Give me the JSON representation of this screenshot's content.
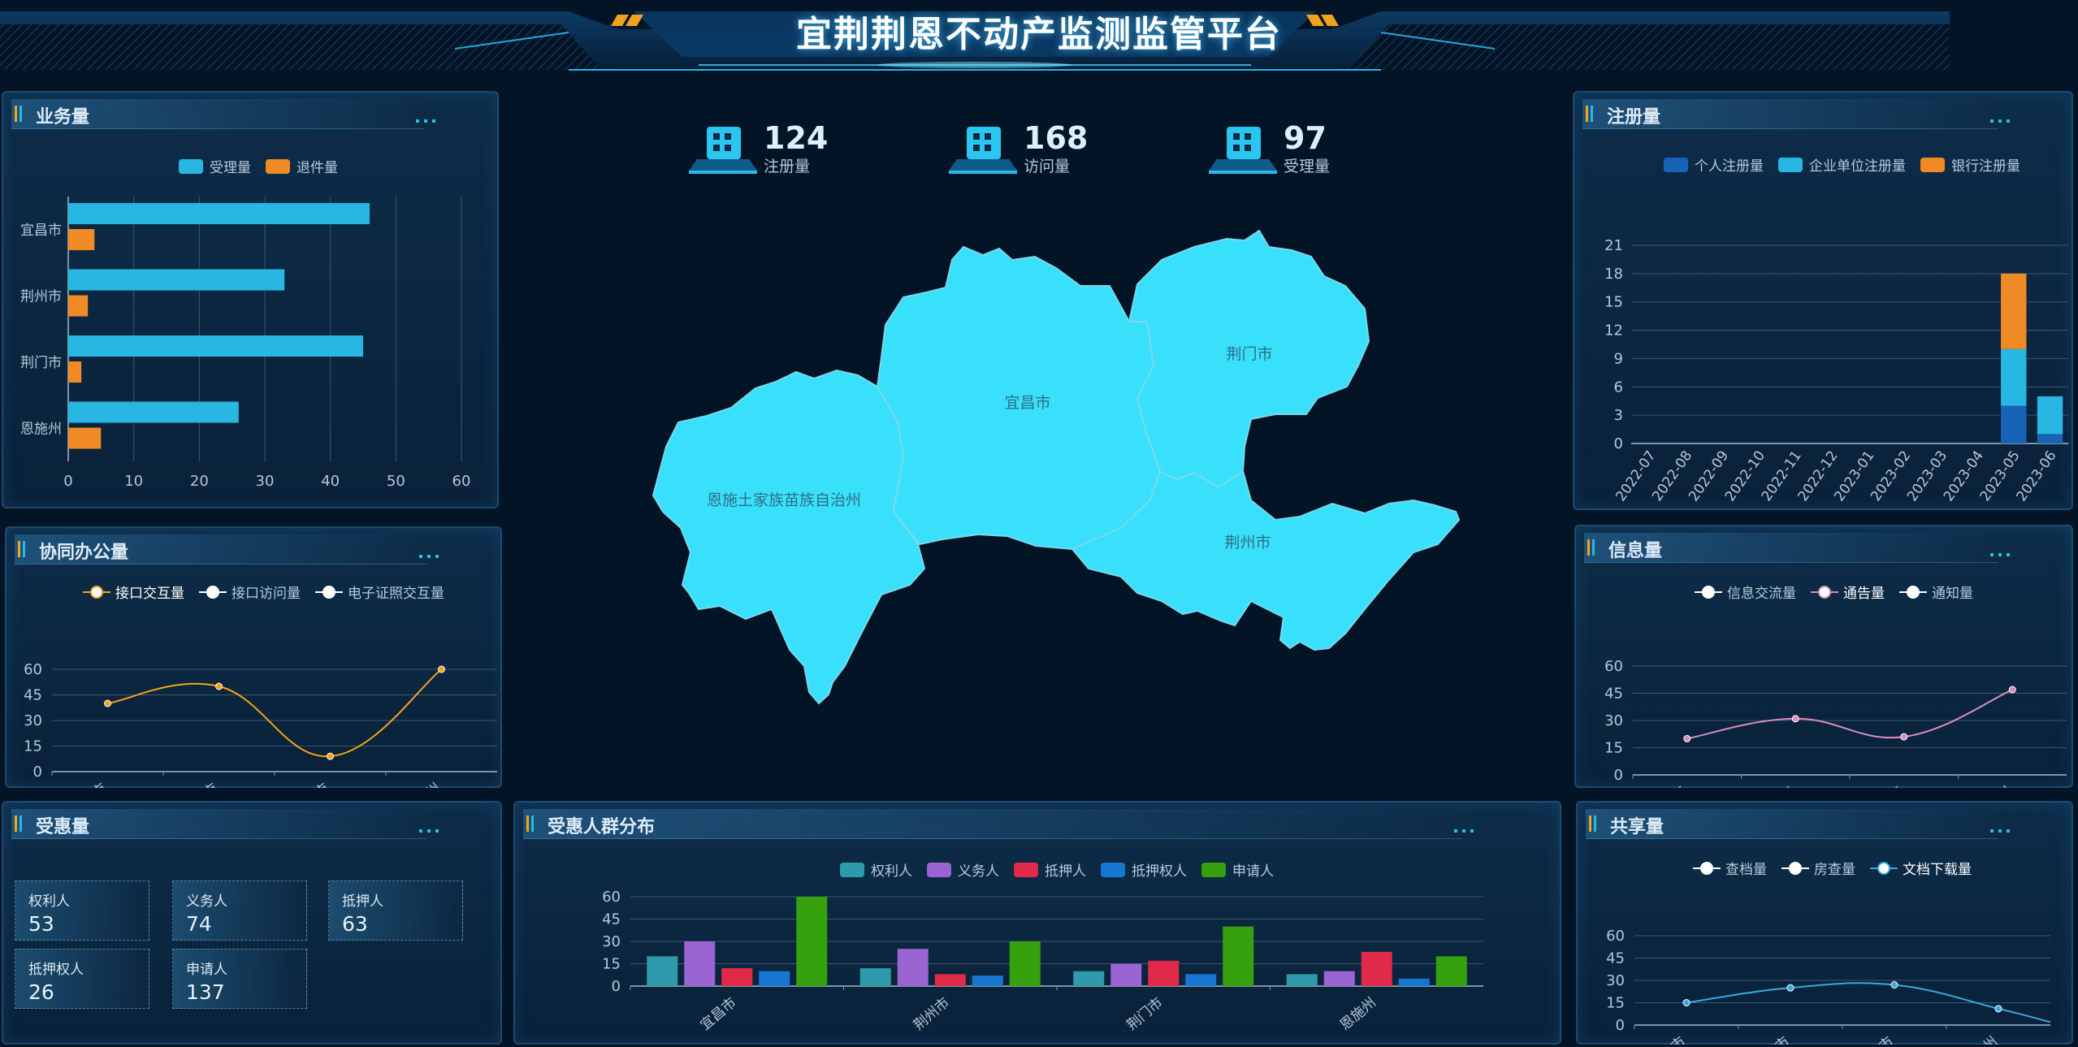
{
  "page": {
    "title": "宜荆荆恩不动产监测监管平台"
  },
  "kpis": [
    {
      "value": "124",
      "label": "注册量"
    },
    {
      "value": "168",
      "label": "访问量"
    },
    {
      "value": "97",
      "label": "受理量"
    }
  ],
  "colors": {
    "cyan": "#28b7e3",
    "orange": "#f08a24",
    "map": "#38e0fb"
  },
  "map": {
    "regions": [
      "宜昌市",
      "荆门市",
      "恩施土家族苗族自治州",
      "荆州市"
    ]
  },
  "beneficiary_cards": [
    {
      "label": "权利人",
      "value": "53"
    },
    {
      "label": "义务人",
      "value": "74"
    },
    {
      "label": "抵押人",
      "value": "63"
    },
    {
      "label": "抵押权人",
      "value": "26"
    },
    {
      "label": "申请人",
      "value": "137"
    }
  ],
  "panels": {
    "business": "业务量",
    "collab": "协同办公量",
    "benefit": "受惠量",
    "register": "注册量",
    "info": "信息量",
    "share": "共享量",
    "crowd": "受惠人群分布"
  },
  "chart_data": [
    {
      "id": "business",
      "type": "bar",
      "orientation": "horizontal",
      "title": "业务量",
      "categories": [
        "宜昌市",
        "荆州市",
        "荆门市",
        "恩施州"
      ],
      "series": [
        {
          "name": "受理量",
          "values": [
            46,
            33,
            45,
            26
          ],
          "color": "#28b7e3"
        },
        {
          "name": "退件量",
          "values": [
            4,
            3,
            2,
            5
          ],
          "color": "#f08a24"
        }
      ],
      "xlim": [
        0,
        60
      ],
      "xticks": [
        "0",
        "10",
        "20",
        "30",
        "40",
        "50",
        "60"
      ]
    },
    {
      "id": "collab",
      "type": "line",
      "title": "协同办公量",
      "categories": [
        "宜昌市",
        "荆州市",
        "荆门市",
        "恩施州"
      ],
      "series": [
        {
          "name": "接口交互量",
          "values": [
            40,
            50,
            9,
            60
          ],
          "color": "#f3a41a"
        },
        {
          "name": "接口访问量",
          "values": [],
          "color": "#ffffff"
        },
        {
          "name": "电子证照交互量",
          "values": [],
          "color": "#ffffff"
        }
      ],
      "ylim": [
        0,
        60
      ],
      "yticks": [
        "0",
        "15",
        "30",
        "45",
        "60"
      ]
    },
    {
      "id": "register",
      "type": "bar",
      "stacked": true,
      "title": "注册量",
      "categories": [
        "2022-07",
        "2022-08",
        "2022-09",
        "2022-10",
        "2022-11",
        "2022-12",
        "2023-01",
        "2023-02",
        "2023-03",
        "2023-04",
        "2023-05",
        "2023-06"
      ],
      "series": [
        {
          "name": "个人注册量",
          "values": [
            0,
            0,
            0,
            0,
            0,
            0,
            0,
            0,
            0,
            0,
            4,
            1
          ],
          "color": "#1763b6"
        },
        {
          "name": "企业单位注册量",
          "values": [
            0,
            0,
            0,
            0,
            0,
            0,
            0,
            0,
            0,
            0,
            6,
            4
          ],
          "color": "#28b7e3"
        },
        {
          "name": "银行注册量",
          "values": [
            0,
            0,
            0,
            0,
            0,
            0,
            0,
            0,
            0,
            0,
            8,
            0
          ],
          "color": "#f08a24"
        }
      ],
      "ylim": [
        0,
        21
      ],
      "yticks": [
        "0",
        "3",
        "6",
        "9",
        "12",
        "15",
        "18",
        "21"
      ]
    },
    {
      "id": "info",
      "type": "line",
      "title": "信息量",
      "categories": [
        "宜昌市",
        "荆州市",
        "荆门市",
        "恩施州"
      ],
      "series": [
        {
          "name": "信息交流量",
          "values": [],
          "color": "#ffffff"
        },
        {
          "name": "通告量",
          "values": [
            20,
            31,
            21,
            47
          ],
          "color": "#d98cc0"
        },
        {
          "name": "通知量",
          "values": [],
          "color": "#ffffff"
        }
      ],
      "ylim": [
        0,
        60
      ],
      "yticks": [
        "0",
        "15",
        "30",
        "45",
        "60"
      ]
    },
    {
      "id": "share",
      "type": "line",
      "title": "共享量",
      "categories": [
        "宜昌市",
        "荆州市",
        "荆门市",
        "恩施州"
      ],
      "series": [
        {
          "name": "查档量",
          "values": [],
          "color": "#ffffff"
        },
        {
          "name": "房查量",
          "values": [],
          "color": "#ffffff"
        },
        {
          "name": "文档下载量",
          "values": [
            15,
            25,
            27,
            11,
            2
          ],
          "color": "#3aa8e0"
        }
      ],
      "ylim": [
        0,
        60
      ],
      "yticks": [
        "0",
        "15",
        "30",
        "45",
        "60"
      ]
    },
    {
      "id": "crowd",
      "type": "bar",
      "title": "受惠人群分布",
      "categories": [
        "宜昌市",
        "荆州市",
        "荆门市",
        "恩施州"
      ],
      "series": [
        {
          "name": "权利人",
          "values": [
            20,
            12,
            10,
            8
          ],
          "color": "#2e9aad"
        },
        {
          "name": "义务人",
          "values": [
            30,
            25,
            15,
            10
          ],
          "color": "#9a64d2"
        },
        {
          "name": "抵押人",
          "values": [
            12,
            8,
            17,
            23
          ],
          "color": "#e12a4a"
        },
        {
          "name": "抵押权人",
          "values": [
            10,
            7,
            8,
            5
          ],
          "color": "#1677d2"
        },
        {
          "name": "申请人",
          "values": [
            60,
            30,
            40,
            20
          ],
          "color": "#34a10d"
        }
      ],
      "ylim": [
        0,
        60
      ],
      "yticks": [
        "0",
        "15",
        "30",
        "45",
        "60"
      ]
    }
  ]
}
